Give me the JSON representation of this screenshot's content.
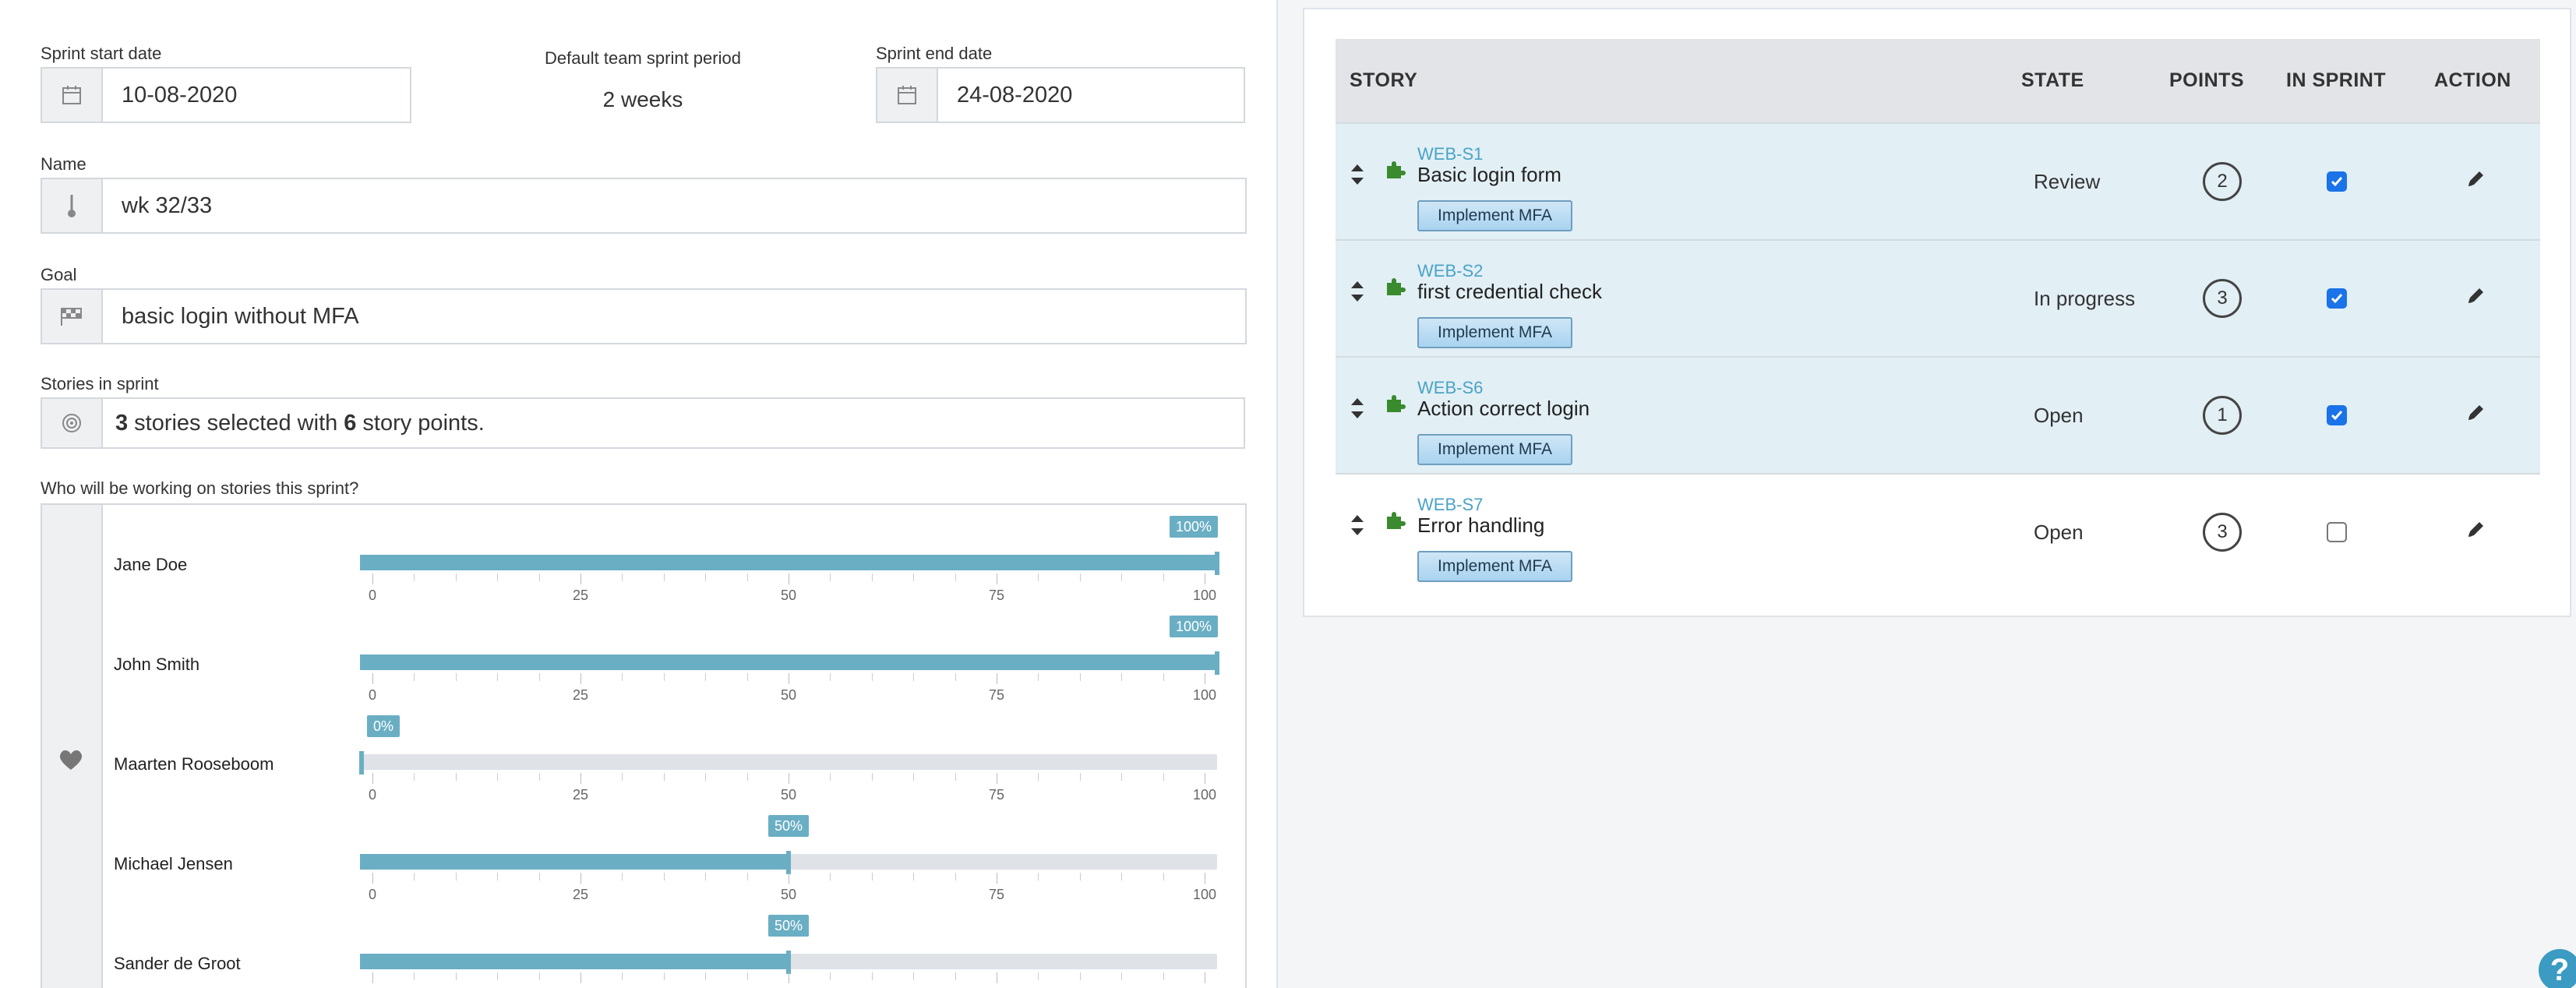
{
  "form": {
    "start_label": "Sprint start date",
    "start_value": "10-08-2020",
    "period_label": "Default team sprint period",
    "period_value": "2 weeks",
    "end_label": "Sprint end date",
    "end_value": "24-08-2020",
    "name_label": "Name",
    "name_value": "wk 32/33",
    "goal_label": "Goal",
    "goal_value": "basic login without MFA",
    "stories_label": "Stories in sprint",
    "stories_count": "3",
    "stories_mid": "stories selected with",
    "stories_points": "6",
    "stories_end": "story points.",
    "workload_label": "Who will be working on stories this sprint?"
  },
  "workload": {
    "tick_labels": [
      "0",
      "25",
      "50",
      "75",
      "100"
    ],
    "people": [
      {
        "name": "Jane Doe",
        "percent": 100,
        "label": "100%"
      },
      {
        "name": "John Smith",
        "percent": 100,
        "label": "100%"
      },
      {
        "name": "Maarten Rooseboom",
        "percent": 0,
        "label": "0%"
      },
      {
        "name": "Michael Jensen",
        "percent": 50,
        "label": "50%"
      },
      {
        "name": "Sander de Groot",
        "percent": 50,
        "label": "50%"
      }
    ]
  },
  "table": {
    "headers": {
      "story": "STORY",
      "state": "STATE",
      "points": "POINTS",
      "in_sprint": "IN SPRINT",
      "action": "ACTION"
    },
    "rows": [
      {
        "key": "WEB-S1",
        "title": "Basic login form",
        "epic": "Implement MFA",
        "state": "Review",
        "points": "2",
        "in_sprint": true
      },
      {
        "key": "WEB-S2",
        "title": "first credential check",
        "epic": "Implement MFA",
        "state": "In progress",
        "points": "3",
        "in_sprint": true
      },
      {
        "key": "WEB-S6",
        "title": "Action correct login",
        "epic": "Implement MFA",
        "state": "Open",
        "points": "1",
        "in_sprint": true
      },
      {
        "key": "WEB-S7",
        "title": "Error handling",
        "epic": "Implement MFA",
        "state": "Open",
        "points": "3",
        "in_sprint": false
      }
    ]
  },
  "help": {
    "label": "?"
  },
  "colors": {
    "accent": "#6aaec4",
    "link": "#4aa3c6",
    "in_sprint_row": "#e2eff5"
  },
  "icons": [
    "calendar-icon",
    "thermometer-icon",
    "flag-icon",
    "target-icon",
    "heart-icon",
    "drag-icon",
    "puzzle-icon",
    "pencil-icon",
    "help-icon"
  ]
}
